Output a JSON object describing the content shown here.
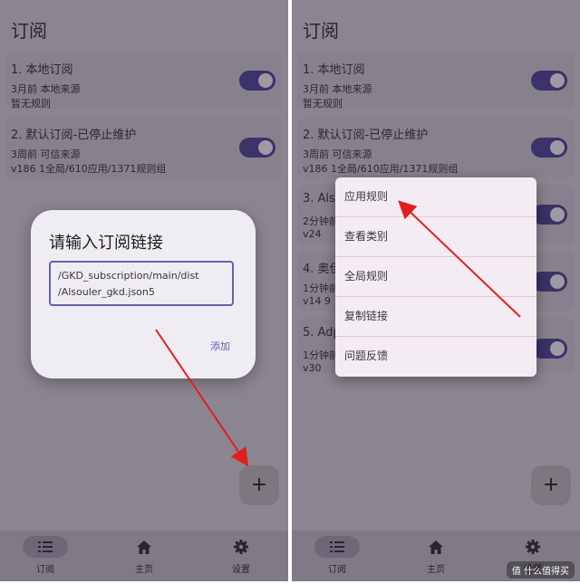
{
  "left": {
    "title": "订阅",
    "cards": [
      {
        "name": "1. 本地订阅",
        "meta": "3月前   本地来源",
        "meta2": "暂无规则"
      },
      {
        "name": "2. 默认订阅-已停止维护",
        "meta": "3周前   可信来源",
        "meta2": "v186   1全局/610应用/1371规则组"
      }
    ],
    "dialog": {
      "title": "请输入订阅链接",
      "field_value": "/GKD_subscription/main/dist\n/Alsouler_gkd.json5",
      "confirm": "添加"
    },
    "fab": "+",
    "nav": [
      {
        "icon": "list-icon",
        "label": "订阅"
      },
      {
        "icon": "home-icon",
        "label": "主页"
      },
      {
        "icon": "gear-icon",
        "label": "设置"
      }
    ]
  },
  "right": {
    "title": "订阅",
    "cards": [
      {
        "name": "1. 本地订阅",
        "meta": "3月前   本地来源",
        "meta2": "暂无规则"
      },
      {
        "name": "2. 默认订阅-已停止维护",
        "meta": "3周前   可信来源",
        "meta2": "v186   1全局/610应用/1371规则组"
      },
      {
        "name": "3. Also",
        "meta": "2分钟前",
        "meta2": "v24"
      },
      {
        "name": "4. 奥伊",
        "meta": "1分钟前",
        "meta2": "v14   9"
      },
      {
        "name": "5. Adp",
        "meta": "1分钟前",
        "meta2": "v30"
      }
    ],
    "menu": [
      "应用规则",
      "查看类别",
      "全局规则",
      "复制链接",
      "问题反馈"
    ],
    "fab": "+",
    "nav": [
      {
        "icon": "list-icon",
        "label": "订阅"
      },
      {
        "icon": "home-icon",
        "label": "主页"
      },
      {
        "icon": "gear-icon",
        "label": "设置"
      }
    ]
  },
  "watermark": "值 什么值得买",
  "colors": {
    "accent": "#6a5fa8",
    "toggle": "#3a3268",
    "arrow": "#e02020"
  }
}
